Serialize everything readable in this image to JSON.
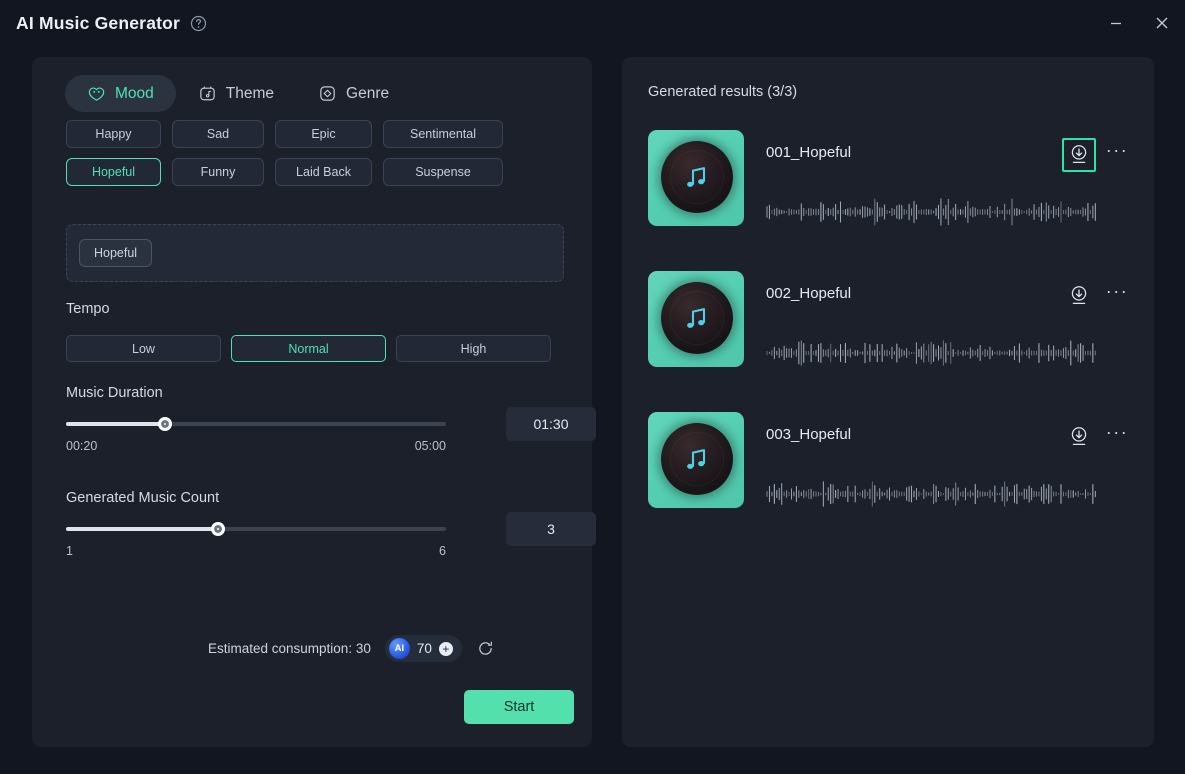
{
  "window": {
    "title": "AI Music Generator",
    "help_icon": "question-circle-icon",
    "minimize_label": "—",
    "close_label": "✕"
  },
  "left_panel": {
    "tabs": [
      {
        "label": "Mood",
        "icon": "mood-face-icon",
        "active": true
      },
      {
        "label": "Theme",
        "icon": "theme-music-icon",
        "active": false
      },
      {
        "label": "Genre",
        "icon": "genre-disc-icon",
        "active": false
      }
    ],
    "mood_chips": [
      {
        "label": "Happy",
        "selected": false,
        "width": "w1"
      },
      {
        "label": "Sad",
        "selected": false,
        "width": "w2"
      },
      {
        "label": "Epic",
        "selected": false,
        "width": "w3"
      },
      {
        "label": "Sentimental",
        "selected": false,
        "width": "w4"
      },
      {
        "label": "Hopeful",
        "selected": true,
        "width": "w1"
      },
      {
        "label": "Funny",
        "selected": false,
        "width": "w2"
      },
      {
        "label": "Laid Back",
        "selected": false,
        "width": "w3"
      },
      {
        "label": "Suspense",
        "selected": false,
        "width": "w4"
      }
    ],
    "selected_tags": [
      "Hopeful"
    ],
    "tempo": {
      "label": "Tempo",
      "options": [
        {
          "label": "Low",
          "selected": false
        },
        {
          "label": "Normal",
          "selected": true
        },
        {
          "label": "High",
          "selected": false
        }
      ]
    },
    "music_duration": {
      "label": "Music Duration",
      "min_label": "00:20",
      "max_label": "05:00",
      "value_label": "01:30",
      "fill_percent": 26
    },
    "music_count": {
      "label": "Generated Music Count",
      "min_label": "1",
      "max_label": "6",
      "value_label": "3",
      "fill_percent": 40
    },
    "footer": {
      "consumption_text": "Estimated consumption: 30",
      "ai_badge_text": "AI",
      "credits": "70",
      "plus_label": "+",
      "refresh_icon": "refresh-icon",
      "start_label": "Start"
    }
  },
  "right_panel": {
    "results_title": "Generated results (3/3)",
    "results": [
      {
        "name": "001_Hopeful",
        "thumbnail_icon": "music-note-disc-icon",
        "download_icon": "download-circle-icon",
        "download_highlighted": true,
        "more_icon": "more-dots-icon"
      },
      {
        "name": "002_Hopeful",
        "thumbnail_icon": "music-note-disc-icon",
        "download_icon": "download-circle-icon",
        "download_highlighted": false,
        "more_icon": "more-dots-icon"
      },
      {
        "name": "003_Hopeful",
        "thumbnail_icon": "music-note-disc-icon",
        "download_icon": "download-circle-icon",
        "download_highlighted": false,
        "more_icon": "more-dots-icon"
      }
    ],
    "more_label": "···"
  },
  "colors": {
    "background": "#111620",
    "panel": "#1b202b",
    "accent_teal": "#4fe0b2",
    "accent_highlight": "#2fe3a8",
    "start_button": "#53e0ad",
    "text_primary": "#e6ebf2",
    "text_secondary": "#c8cfdb",
    "thumb_teal": "#55cfb2",
    "note_cyan": "#4ad0ea"
  }
}
